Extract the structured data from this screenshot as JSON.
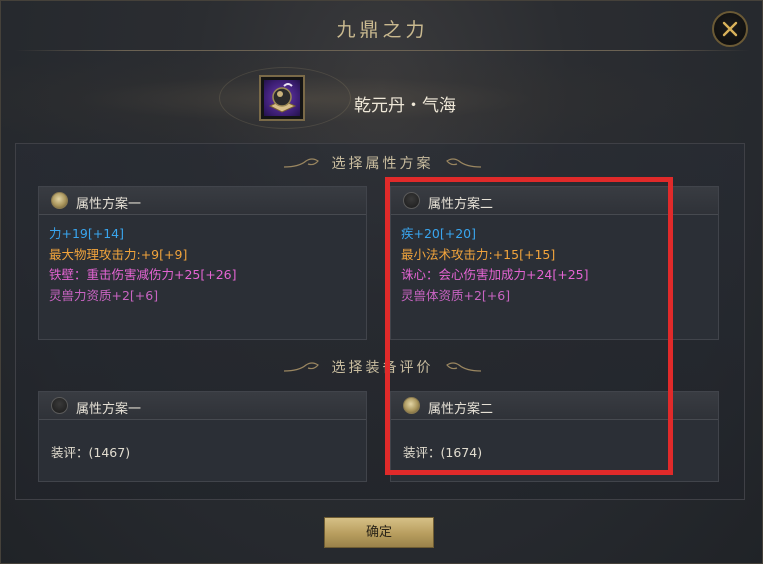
{
  "dialog": {
    "title": "九鼎之力",
    "close_icon": "close-icon"
  },
  "item": {
    "name": "乾元丹・气海",
    "icon": "dan-pill-icon"
  },
  "section1": {
    "title": "选择属性方案"
  },
  "section2": {
    "title": "选择装备评价"
  },
  "attr_cards": [
    {
      "title": "属性方案一",
      "selected": true,
      "attributes": [
        {
          "text": "力+19[+14]",
          "color": "#39a5ee"
        },
        {
          "text": "最大物理攻击力:+9[+9]",
          "color": "#f0a33c"
        },
        {
          "text": "铁壁：重击伤害减伤力+25[+26]",
          "color": "#e364d2"
        },
        {
          "text": "灵兽力资质+2[+6]",
          "color": "#c864c2"
        }
      ]
    },
    {
      "title": "属性方案二",
      "selected": false,
      "attributes": [
        {
          "text": "疾+20[+20]",
          "color": "#39a5ee"
        },
        {
          "text": "最小法术攻击力:+15[+15]",
          "color": "#f0a33c"
        },
        {
          "text": "诛心：会心伤害加成力+24[+25]",
          "color": "#e364d2"
        },
        {
          "text": "灵兽体资质+2[+6]",
          "color": "#c864c2"
        }
      ]
    }
  ],
  "score_cards": [
    {
      "title": "属性方案一",
      "selected": false,
      "score": "装评：(1467)"
    },
    {
      "title": "属性方案二",
      "selected": true,
      "score": "装评：(1674)"
    }
  ],
  "confirm_button": {
    "label": "确定"
  },
  "highlight_color": "#e02a2a"
}
